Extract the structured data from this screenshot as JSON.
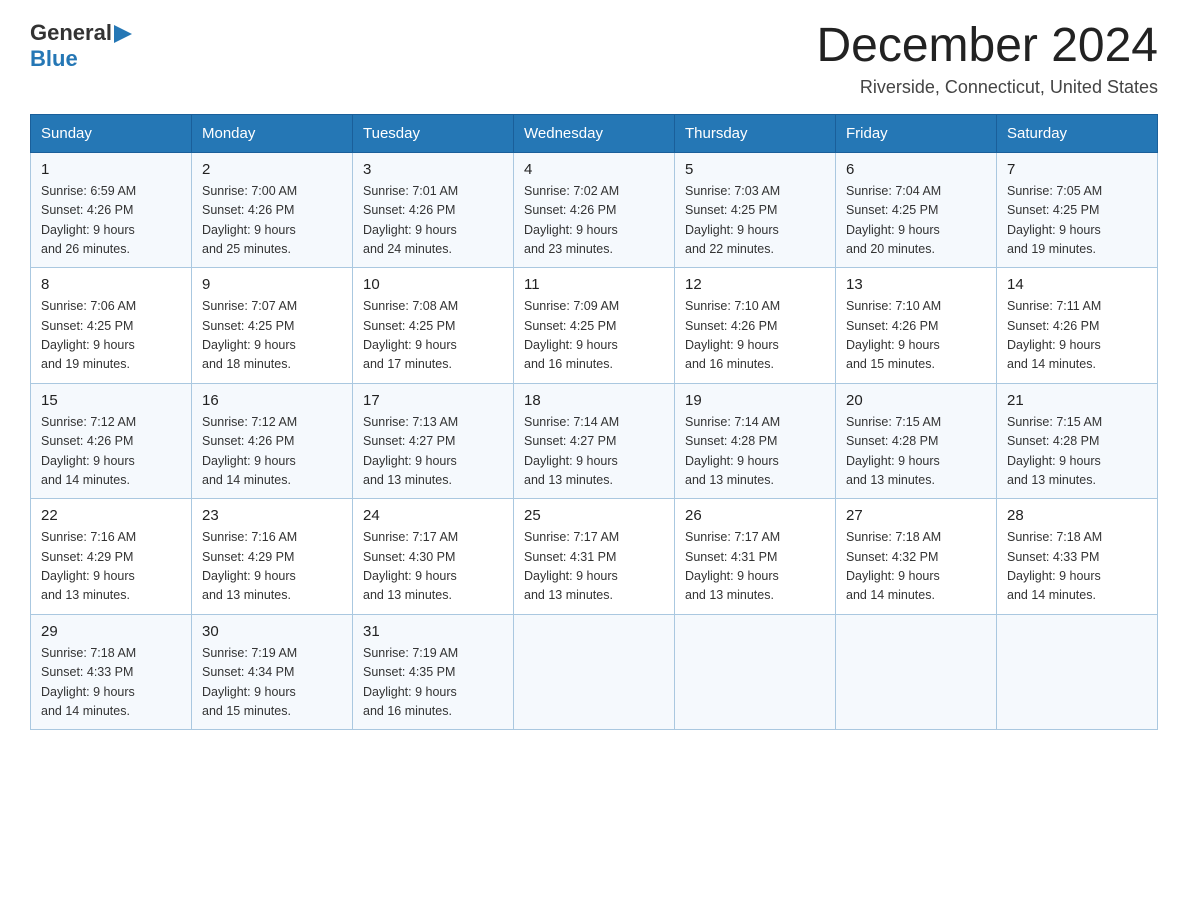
{
  "header": {
    "title": "December 2024",
    "subtitle": "Riverside, Connecticut, United States",
    "logo_general": "General",
    "logo_blue": "Blue"
  },
  "weekdays": [
    "Sunday",
    "Monday",
    "Tuesday",
    "Wednesday",
    "Thursday",
    "Friday",
    "Saturday"
  ],
  "weeks": [
    [
      {
        "day": "1",
        "sunrise": "6:59 AM",
        "sunset": "4:26 PM",
        "daylight": "9 hours and 26 minutes."
      },
      {
        "day": "2",
        "sunrise": "7:00 AM",
        "sunset": "4:26 PM",
        "daylight": "9 hours and 25 minutes."
      },
      {
        "day": "3",
        "sunrise": "7:01 AM",
        "sunset": "4:26 PM",
        "daylight": "9 hours and 24 minutes."
      },
      {
        "day": "4",
        "sunrise": "7:02 AM",
        "sunset": "4:26 PM",
        "daylight": "9 hours and 23 minutes."
      },
      {
        "day": "5",
        "sunrise": "7:03 AM",
        "sunset": "4:25 PM",
        "daylight": "9 hours and 22 minutes."
      },
      {
        "day": "6",
        "sunrise": "7:04 AM",
        "sunset": "4:25 PM",
        "daylight": "9 hours and 20 minutes."
      },
      {
        "day": "7",
        "sunrise": "7:05 AM",
        "sunset": "4:25 PM",
        "daylight": "9 hours and 19 minutes."
      }
    ],
    [
      {
        "day": "8",
        "sunrise": "7:06 AM",
        "sunset": "4:25 PM",
        "daylight": "9 hours and 19 minutes."
      },
      {
        "day": "9",
        "sunrise": "7:07 AM",
        "sunset": "4:25 PM",
        "daylight": "9 hours and 18 minutes."
      },
      {
        "day": "10",
        "sunrise": "7:08 AM",
        "sunset": "4:25 PM",
        "daylight": "9 hours and 17 minutes."
      },
      {
        "day": "11",
        "sunrise": "7:09 AM",
        "sunset": "4:25 PM",
        "daylight": "9 hours and 16 minutes."
      },
      {
        "day": "12",
        "sunrise": "7:10 AM",
        "sunset": "4:26 PM",
        "daylight": "9 hours and 16 minutes."
      },
      {
        "day": "13",
        "sunrise": "7:10 AM",
        "sunset": "4:26 PM",
        "daylight": "9 hours and 15 minutes."
      },
      {
        "day": "14",
        "sunrise": "7:11 AM",
        "sunset": "4:26 PM",
        "daylight": "9 hours and 14 minutes."
      }
    ],
    [
      {
        "day": "15",
        "sunrise": "7:12 AM",
        "sunset": "4:26 PM",
        "daylight": "9 hours and 14 minutes."
      },
      {
        "day": "16",
        "sunrise": "7:12 AM",
        "sunset": "4:26 PM",
        "daylight": "9 hours and 14 minutes."
      },
      {
        "day": "17",
        "sunrise": "7:13 AM",
        "sunset": "4:27 PM",
        "daylight": "9 hours and 13 minutes."
      },
      {
        "day": "18",
        "sunrise": "7:14 AM",
        "sunset": "4:27 PM",
        "daylight": "9 hours and 13 minutes."
      },
      {
        "day": "19",
        "sunrise": "7:14 AM",
        "sunset": "4:28 PM",
        "daylight": "9 hours and 13 minutes."
      },
      {
        "day": "20",
        "sunrise": "7:15 AM",
        "sunset": "4:28 PM",
        "daylight": "9 hours and 13 minutes."
      },
      {
        "day": "21",
        "sunrise": "7:15 AM",
        "sunset": "4:28 PM",
        "daylight": "9 hours and 13 minutes."
      }
    ],
    [
      {
        "day": "22",
        "sunrise": "7:16 AM",
        "sunset": "4:29 PM",
        "daylight": "9 hours and 13 minutes."
      },
      {
        "day": "23",
        "sunrise": "7:16 AM",
        "sunset": "4:29 PM",
        "daylight": "9 hours and 13 minutes."
      },
      {
        "day": "24",
        "sunrise": "7:17 AM",
        "sunset": "4:30 PM",
        "daylight": "9 hours and 13 minutes."
      },
      {
        "day": "25",
        "sunrise": "7:17 AM",
        "sunset": "4:31 PM",
        "daylight": "9 hours and 13 minutes."
      },
      {
        "day": "26",
        "sunrise": "7:17 AM",
        "sunset": "4:31 PM",
        "daylight": "9 hours and 13 minutes."
      },
      {
        "day": "27",
        "sunrise": "7:18 AM",
        "sunset": "4:32 PM",
        "daylight": "9 hours and 14 minutes."
      },
      {
        "day": "28",
        "sunrise": "7:18 AM",
        "sunset": "4:33 PM",
        "daylight": "9 hours and 14 minutes."
      }
    ],
    [
      {
        "day": "29",
        "sunrise": "7:18 AM",
        "sunset": "4:33 PM",
        "daylight": "9 hours and 14 minutes."
      },
      {
        "day": "30",
        "sunrise": "7:19 AM",
        "sunset": "4:34 PM",
        "daylight": "9 hours and 15 minutes."
      },
      {
        "day": "31",
        "sunrise": "7:19 AM",
        "sunset": "4:35 PM",
        "daylight": "9 hours and 16 minutes."
      },
      null,
      null,
      null,
      null
    ]
  ],
  "labels": {
    "sunrise": "Sunrise:",
    "sunset": "Sunset:",
    "daylight": "Daylight: 9 hours"
  }
}
